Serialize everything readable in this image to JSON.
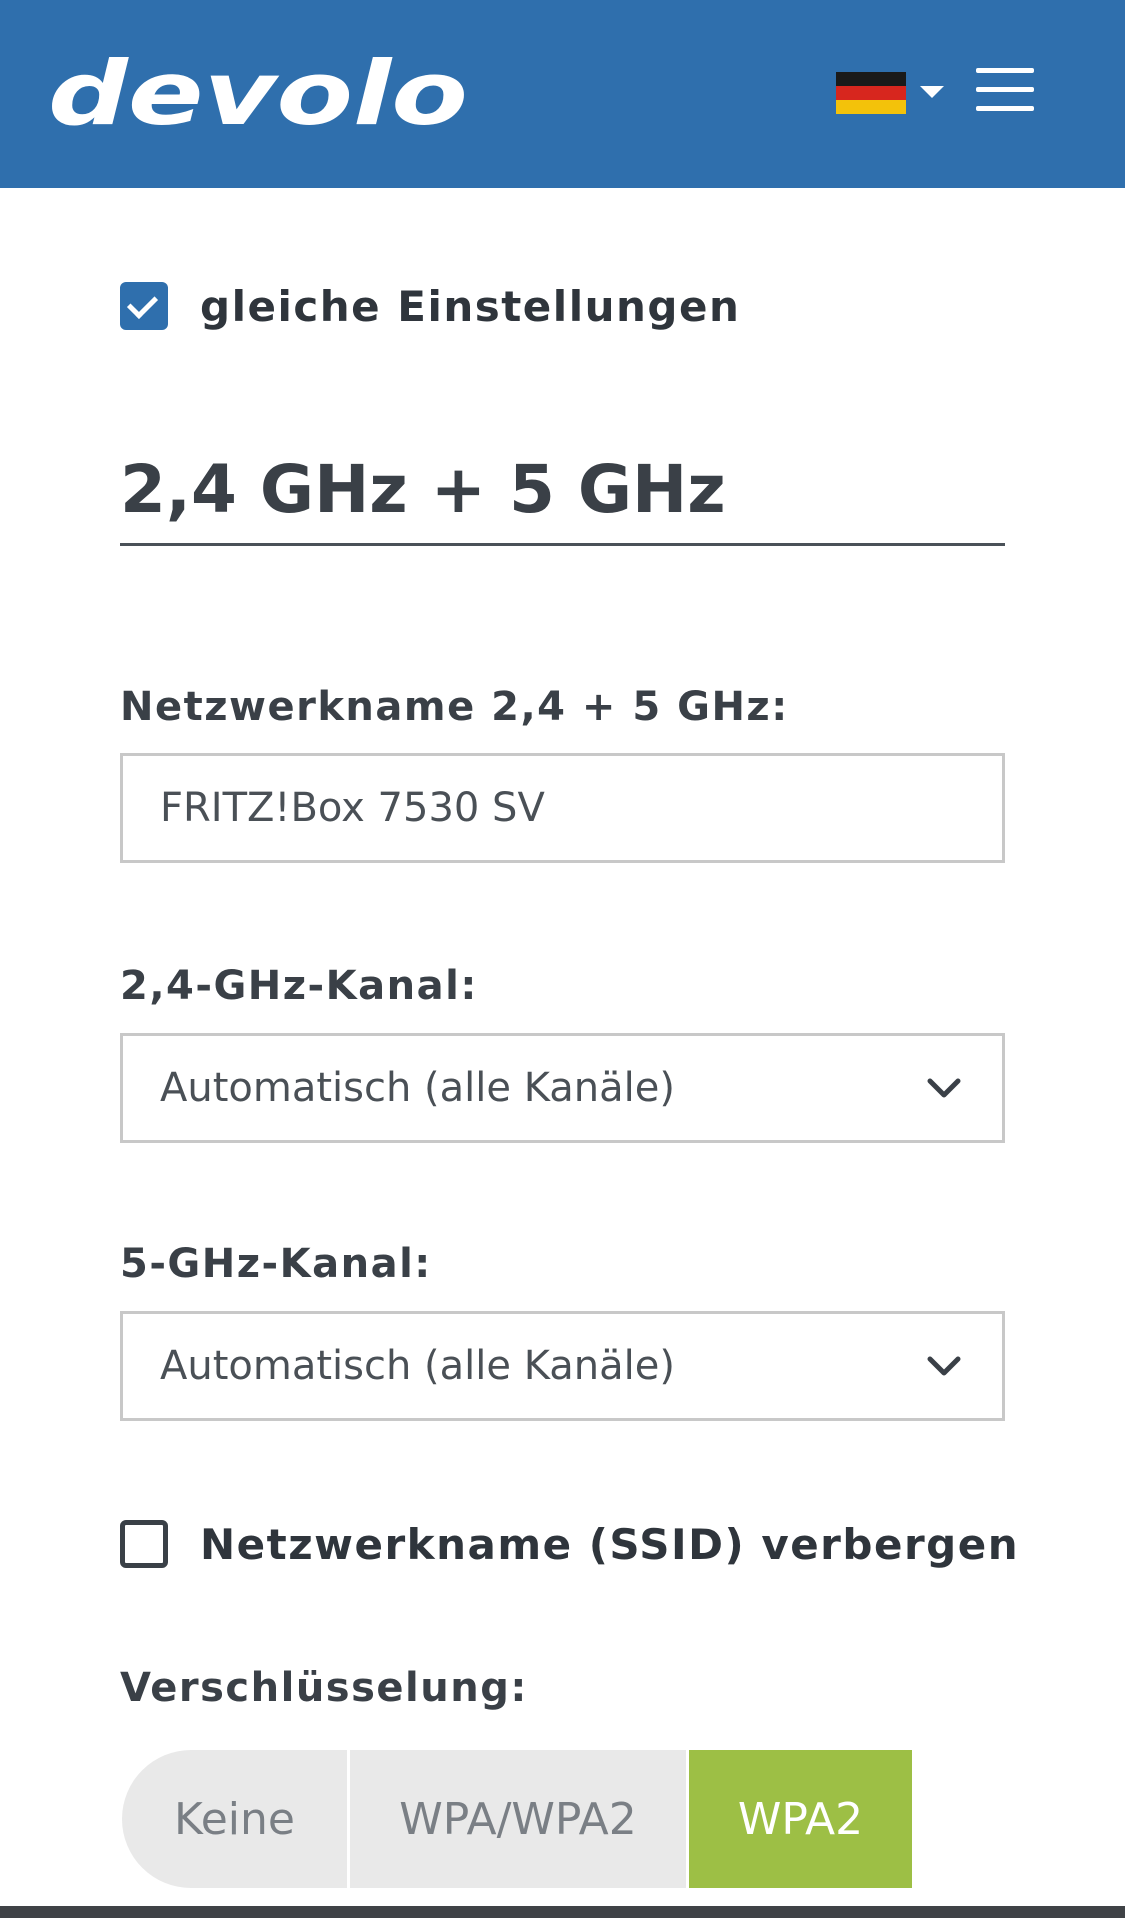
{
  "header": {
    "logo_text": "devolo",
    "language": "Deutsch",
    "colors": {
      "bar": "#2f6fad",
      "flag": [
        "#1a1a1a",
        "#d7261e",
        "#f3c20a"
      ]
    },
    "icons": {
      "menu": "hamburger-menu-icon",
      "language_caret": "caret-down-icon"
    }
  },
  "form": {
    "same_settings": {
      "label": "gleiche Einstellungen",
      "checked": true
    },
    "section_title": "2,4 GHz + 5 GHz",
    "network_name": {
      "label": "Netzwerkname 2,4 + 5 GHz:",
      "value": "FRITZ!Box 7530 SV"
    },
    "channel_24": {
      "label": "2,4-GHz-Kanal:",
      "value": "Automatisch (alle Kanäle)"
    },
    "channel_5": {
      "label": "5-GHz-Kanal:",
      "value": "Automatisch (alle Kanäle)"
    },
    "hide_ssid": {
      "label": "Netzwerkname (SSID) verbergen",
      "checked": false
    },
    "encryption": {
      "label": "Verschlüsselung:",
      "options": [
        "Keine",
        "WPA/WPA2",
        "WPA2"
      ],
      "selected": "WPA2",
      "active_color": "#9dbf45"
    }
  }
}
